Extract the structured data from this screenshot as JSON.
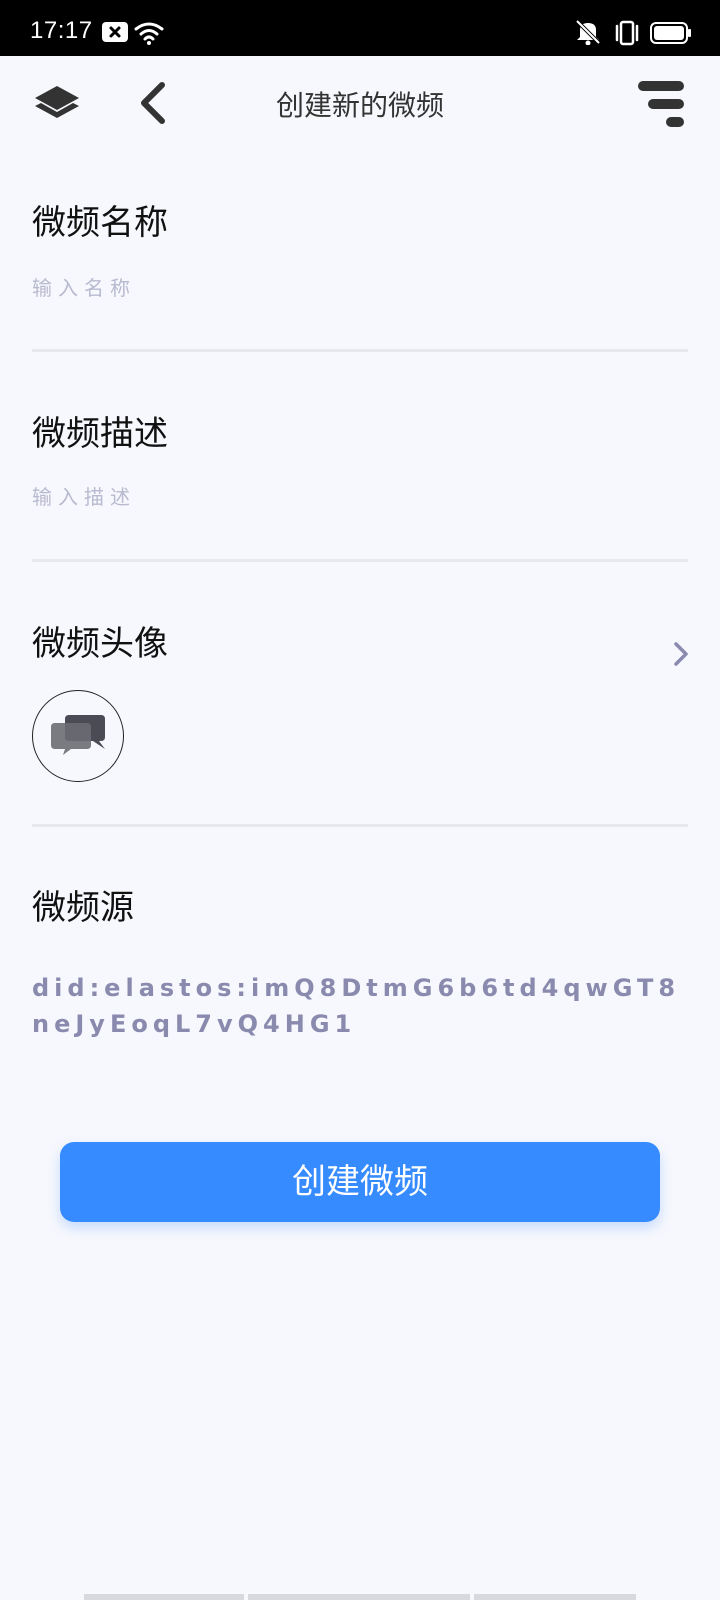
{
  "status_bar": {
    "time": "17:17",
    "icons": [
      "notification-icon",
      "wifi-icon",
      "mute-icon",
      "vibrate-icon",
      "battery-icon"
    ]
  },
  "header": {
    "title": "创建新的微频",
    "left_icons": [
      "layers-icon",
      "back-icon"
    ],
    "right_icon": "menu-icon"
  },
  "form": {
    "name": {
      "label": "微频名称",
      "placeholder": "输入名称",
      "value": ""
    },
    "description": {
      "label": "微频描述",
      "placeholder": "输入描述",
      "value": ""
    },
    "avatar": {
      "label": "微频头像",
      "icon": "chat-bubbles-icon"
    },
    "source": {
      "label": "微频源",
      "did": "did:elastos:imQ8DtmG6b6td4qwGT8neJyEoqL7vQ4HG1"
    }
  },
  "actions": {
    "create_label": "创建微频"
  },
  "colors": {
    "background": "#f7f8fd",
    "accent": "#368bff",
    "did_text": "#8a8aaf",
    "placeholder": "#b9b9d0",
    "divider": "#e7e8ee"
  }
}
